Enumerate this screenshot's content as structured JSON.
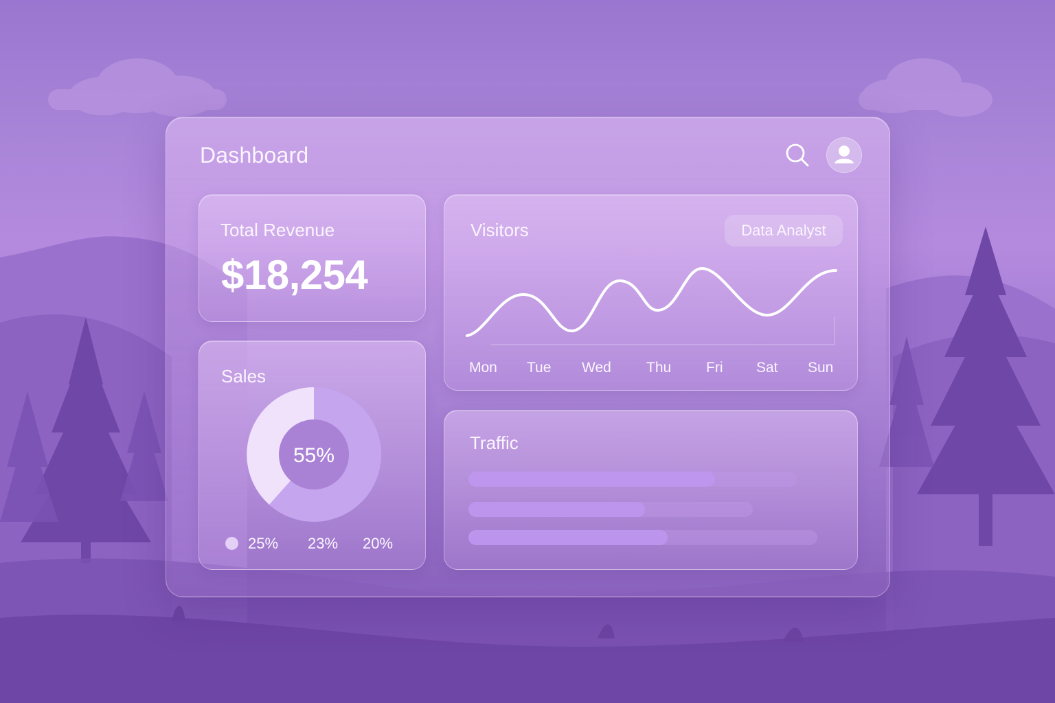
{
  "header": {
    "title": "Dashboard",
    "search_icon": "search-icon",
    "avatar_icon": "user-icon"
  },
  "revenue": {
    "label": "Total Revenue",
    "value": "$18,254"
  },
  "sales": {
    "label": "Sales",
    "center_value": "55%",
    "legend": [
      "25%",
      "23%",
      "20%"
    ]
  },
  "visitors": {
    "label": "Visitors",
    "chip": "Data Analyst",
    "days": [
      "Mon",
      "Tue",
      "Wed",
      "Thu",
      "Fri",
      "Sat",
      "Sun"
    ]
  },
  "traffic": {
    "label": "Traffic",
    "bars": [
      {
        "fill_fraction": 0.75
      },
      {
        "fill_fraction": 0.62
      },
      {
        "fill_fraction": 0.57
      }
    ]
  },
  "colors": {
    "accent": "#c7a6f2",
    "donut_light": "#efe0fb",
    "donut_purple": "#c4a2ee",
    "donut_hole": "#a981d4"
  }
}
